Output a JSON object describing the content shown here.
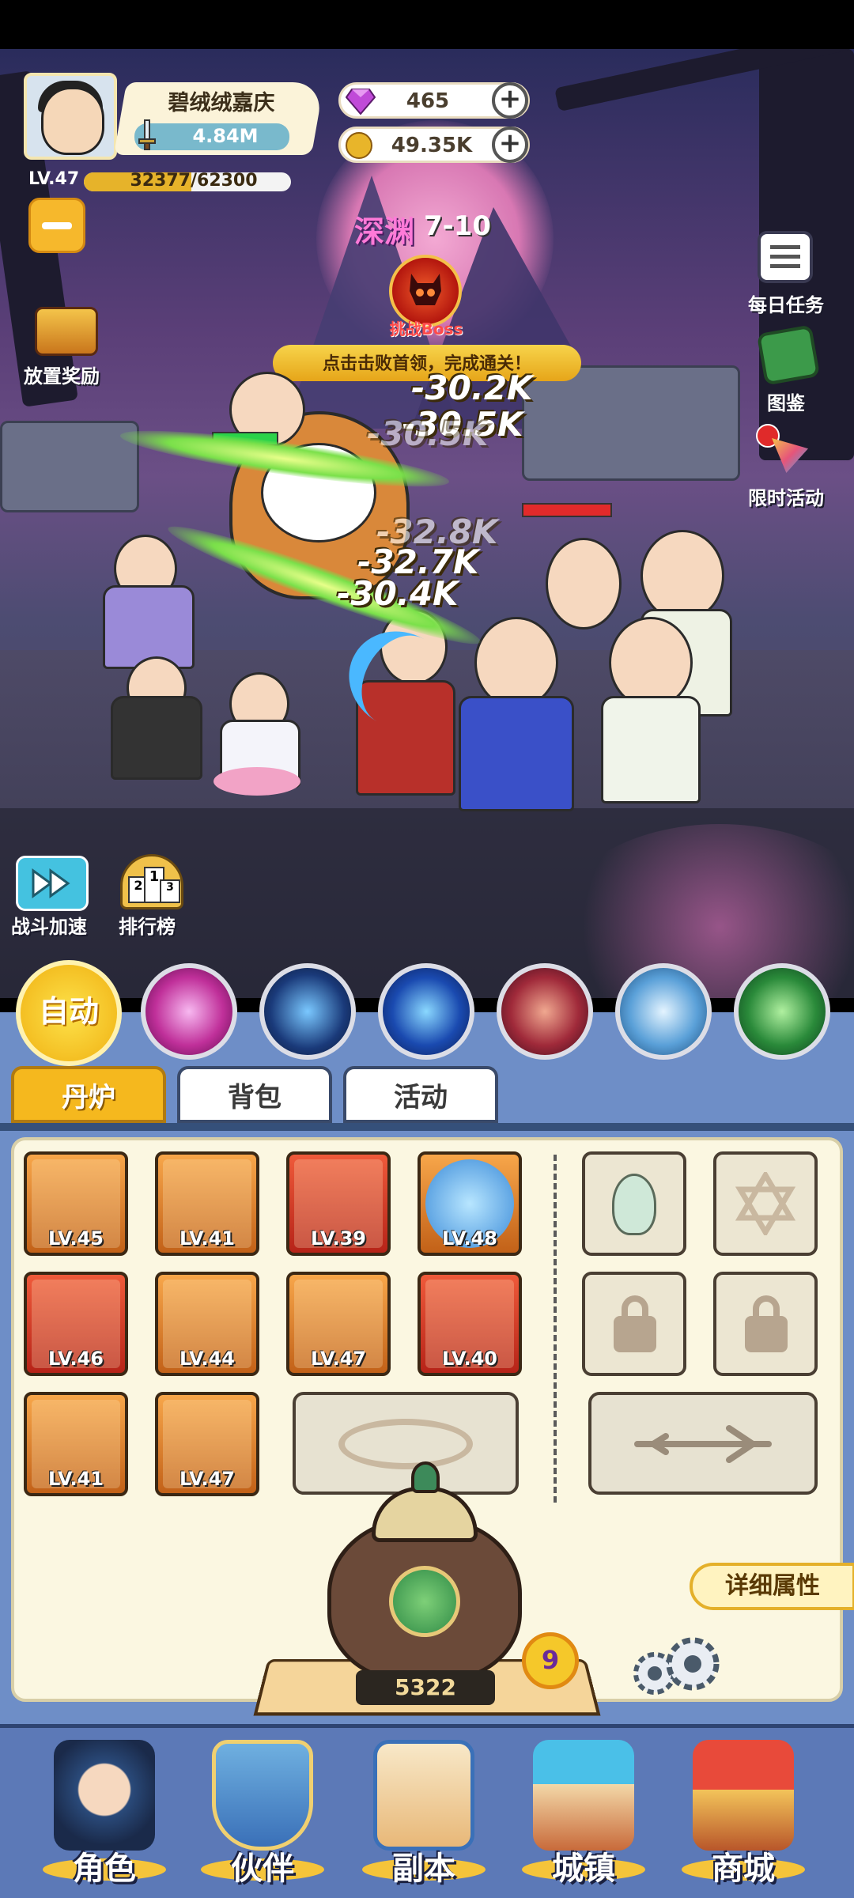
{
  "player": {
    "name": "碧绒绒嘉庆",
    "power": "4.84M",
    "level": "LV.47",
    "exp": "32377/62300",
    "exp_progress": 0.52
  },
  "currency": {
    "gems": "465",
    "coins": "49.35K"
  },
  "stage": {
    "area": "深渊",
    "number": "7-10",
    "boss_label": "挑战Boss",
    "hint": "点击击败首领，完成通关！"
  },
  "left_menu": {
    "idle_reward": "放置奖励",
    "battle_speed": "战斗加速",
    "leaderboard": "排行榜",
    "rank_digits": [
      "2",
      "1",
      "3"
    ]
  },
  "right_menu": {
    "daily_tasks": "每日任务",
    "codex": "图鉴",
    "limited_event": "限时活动"
  },
  "damage_numbers": [
    "-30.2K",
    "-30.5K",
    "-30.5K",
    "-32.8K",
    "-32.7K",
    "-30.4K"
  ],
  "skills": {
    "auto_label": "自动"
  },
  "tabs": [
    "丹炉",
    "背包",
    "活动"
  ],
  "equipment": [
    {
      "lv": "LV.45",
      "rarity": "orange"
    },
    {
      "lv": "LV.41",
      "rarity": "orange"
    },
    {
      "lv": "LV.39",
      "rarity": "red"
    },
    {
      "lv": "LV.48",
      "rarity": "orange"
    },
    {
      "lv": "LV.46",
      "rarity": "red"
    },
    {
      "lv": "LV.44",
      "rarity": "orange"
    },
    {
      "lv": "LV.47",
      "rarity": "orange"
    },
    {
      "lv": "LV.40",
      "rarity": "red"
    },
    {
      "lv": "LV.41",
      "rarity": "orange"
    },
    {
      "lv": "LV.47",
      "rarity": "orange"
    }
  ],
  "furnace": {
    "count": "5322",
    "level": "9",
    "detail_button": "详细属性"
  },
  "bottom_nav": [
    "角色",
    "伙伴",
    "副本",
    "城镇",
    "商城"
  ],
  "colors": {
    "accent_yellow": "#f5c43a",
    "panel_blue": "#6e8ec7",
    "content_bg": "#fbf7e1",
    "gem": "#c04ad8",
    "coin": "#e8b52a"
  }
}
